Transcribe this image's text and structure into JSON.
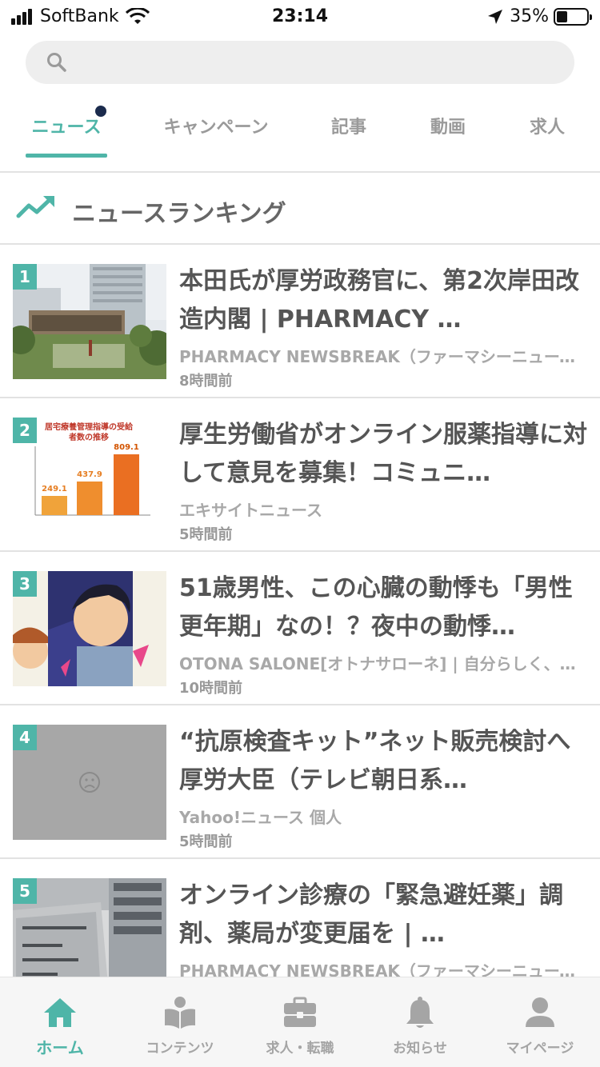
{
  "status_bar": {
    "carrier": "SoftBank",
    "time": "23:14",
    "battery": "35%",
    "battery_level": 0.35
  },
  "search": {
    "placeholder": ""
  },
  "tabs": [
    {
      "label": "ニュース",
      "active": true,
      "has_dot": true
    },
    {
      "label": "キャンペーン",
      "active": false
    },
    {
      "label": "記事",
      "active": false
    },
    {
      "label": "動画",
      "active": false
    },
    {
      "label": "求人",
      "active": false
    }
  ],
  "section": {
    "icon": "trending-up-icon",
    "title": "ニュースランキング"
  },
  "articles": [
    {
      "rank": "1",
      "title": "本田氏が厚労政務官に、第2次岸田改造内閣 | PHARMACY …",
      "source": "PHARMACY NEWSBREAK（ファーマシーニュースブレイク）",
      "time": "8時間前"
    },
    {
      "rank": "2",
      "title": "厚生労働省がオンライン服薬指導に対して意見を募集！コミュニ…",
      "source": "エキサイトニュース",
      "time": "5時間前",
      "thumb_chart": {
        "title": "居宅療養管理指導の受給者数の推移",
        "values": [
          "249.1",
          "437.9",
          "809.1"
        ]
      }
    },
    {
      "rank": "3",
      "title": "51歳男性、この心臓の動悸も「男性更年期」なの！？夜中の動悸…",
      "source": "OTONA SALONE[オトナサローネ] | 自分らしく、欲張りに。",
      "time": "10時間前"
    },
    {
      "rank": "4",
      "title": "“抗原検査キット”ネット販売検討へ　厚労大臣（テレビ朝日系…",
      "source": "Yahoo!ニュース 個人",
      "time": "5時間前"
    },
    {
      "rank": "5",
      "title": "オンライン診療の「緊急避妊薬」調剤、薬局が変更届を | …",
      "source": "PHARMACY NEWSBREAK（ファーマシーニュースブレイク）",
      "time": ""
    }
  ],
  "bottom_nav": [
    {
      "label": "ホーム",
      "icon": "home-icon",
      "active": true
    },
    {
      "label": "コンテンツ",
      "icon": "book-reader-icon",
      "active": false
    },
    {
      "label": "求人・転職",
      "icon": "briefcase-icon",
      "active": false
    },
    {
      "label": "お知らせ",
      "icon": "bell-icon",
      "active": false
    },
    {
      "label": "マイページ",
      "icon": "user-icon",
      "active": false
    }
  ],
  "colors": {
    "accent": "#4fb5a8",
    "rank_badge": "#4fb5a8",
    "text": "#555555",
    "muted": "#a8a8a8"
  }
}
